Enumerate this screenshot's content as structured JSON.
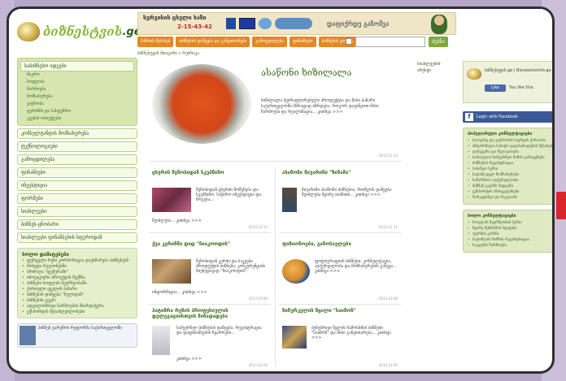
{
  "site": {
    "logo_text": "ბიზნესტვის",
    "logo_suffix": ".ge",
    "accent": "#8ab83a",
    "nav_accent": "#e8861f"
  },
  "banner": {
    "line1": "სერვისის ცხელი ხაზი",
    "phone": "2-15-43-42",
    "slogan": "დაფიქრდე გაზომვა"
  },
  "nav": {
    "items": [
      "ბაზრის შესახებ",
      "ბიზნესის დაწყება და განვითარება",
      "გამოცდილება",
      "ფინანსები",
      "ბიზნესის ცოდნა"
    ],
    "search_button": "ძებნა"
  },
  "breadcrumb": "ბიზნესტვის მთავარი » რუბრიკა",
  "sidebar": {
    "head": "საბიზნესო იდეები",
    "subs": [
      "მიკრო",
      "სოფლის",
      "წარმოება",
      "მომსახურება",
      "ვაჭრობა",
      "ტურიზმი და სასტუმრო",
      "კვების ობიექტები"
    ],
    "items": [
      "კონსულტანტის მომსახურება",
      "ტექნოლოგიები",
      "გამოცდილება",
      "ფინანსები",
      "ინვესტიცია",
      "ფორმები",
      "სიახლეები",
      "ბიზნეს-ცნობარი",
      "სიახლეები ფინანსების სფეროდან"
    ],
    "news_head": "ბოლო დამატებები",
    "news": [
      "ფურცელი რეზი კორპორაცია დაეხმარება ბიზნესებს",
      "მოხვდა რეგიონებში",
      "ბრძოლა \"ფუშურაში\"",
      "ინოვაციური პროექტის შექმნა",
      "ბიზნესი სოფლის მეურნეობაში",
      "ქართული ყველის ბაზარი",
      "ბიზნესის დაწყება \"ნულიდან\"",
      "ბიზნესის გეგმა",
      "ადგილობრივი წარმოების მხარდაჭერა",
      "ექსპორტის შესაძლებლობები"
    ],
    "bottom_text": "ბიზნეს გარემოს რეფორმა საქართველოში"
  },
  "featured": {
    "title": "ასაწონი ხიზილალა",
    "text": "ხიზილალა ძვირადღირებული პროდუქტია და მისი ბაზარი საქართველოში სწრაფად იზრდება. როგორ დავიწყოთ მისი წარმოება და რეალიზაცია... კითხვა >>>",
    "date": "2013-12-23"
  },
  "cards": [
    {
      "title": "ცხვრის შენობიდან სკუპწინო",
      "text": "შენობიდან ცხვრის მოშენება და სკუპწინო, საჭირო ინვესტიცია და მოგება...",
      "more": "შეიძლება... კითხვა >>>",
      "date": "2013-12-12"
    },
    {
      "title": "ასაწონი მიუარინი \"ზინამა\"",
      "text": "მიუარინი ასაწონი ბიზნესია, რომლის დაწყება შეიძლება მცირე თანხით... კითხვა >>>",
      "more": "",
      "date": "2013-12-11"
    },
    {
      "title": "ქვა კერინში დიდ \"ჩიაკოოდის\"",
      "text": "შენობიდან კერძი და საკვები პროდუქტის ბიზნესი, კონკურენციის მიუხედავად \"ჩიაკოოდის\".",
      "more": "ინფორმაცია... კითხვა >>>",
      "date": "2013-12-09"
    },
    {
      "title": "ფიზიონოები, განოსავლები",
      "text": "ფოტოგრაფიის ბიზნესი: კონსულტაცია, აღჭურვილობა და მომსახურების გაწევა... კითხვა >>>",
      "more": "",
      "date": "2013-12-06"
    },
    {
      "title": "პატიმრა რეზის პროფესიულის დელეგაციისთვის წინადადება",
      "text": "სამეურნეო ბიზნესის დაწყება, რეგისტრაცია და დაფინანსების წყაროები...",
      "more": "კითხვა >>>",
      "date": "2013-12-04"
    },
    {
      "title": "ჩინურკვლის წყალი \"საიმონ\"",
      "text": "ბუნებრივი წყლის ჩამოსხმის ბიზნესი \"საიმონ\" და მისი განვითარება... კითხვა >>>",
      "more": "",
      "date": "2013-12-02"
    }
  ],
  "mid": {
    "label": "სიახლეების",
    "sub": "არქივი"
  },
  "right": {
    "fb_name": "ბიზნესტვის.ge | Biznestvisinfo.ge",
    "like_label": "Like",
    "like_count": "You like this.",
    "login_label": "Login with Facebook",
    "box1_head": "პოპულარული კონსულტაციები",
    "box1": [
      "საოფისე და ვაჭრობის სივრცის ქირაობა",
      "ინფორმაცია საბაჟო გადასახადების შესახებ",
      "დაბეგვრა და შეღავათები",
      "სასოფლო-სამეურნეო მიწის გამოყენება",
      "ბიზნესის რეგისტრაცია",
      "საბანკო სესხი",
      "სადაზღვევო მომსახურება",
      "საწარმოო აღჭურვილობა",
      "ბიზნეს გეგმის შედგენა",
      "ექსპორტის პროცედურები",
      "მარკეტინგი და რეკლამა"
    ],
    "box2_head": "ბოლო კონსულტაციები",
    "box2": [
      "სოფლის მეურნეობის სესხი",
      "მცირე მეწარმის სტატუსი",
      "ფერმის გახსნა",
      "საქონლის ნიშნის რეგისტრაცია",
      "საკვების წარმოება"
    ]
  }
}
